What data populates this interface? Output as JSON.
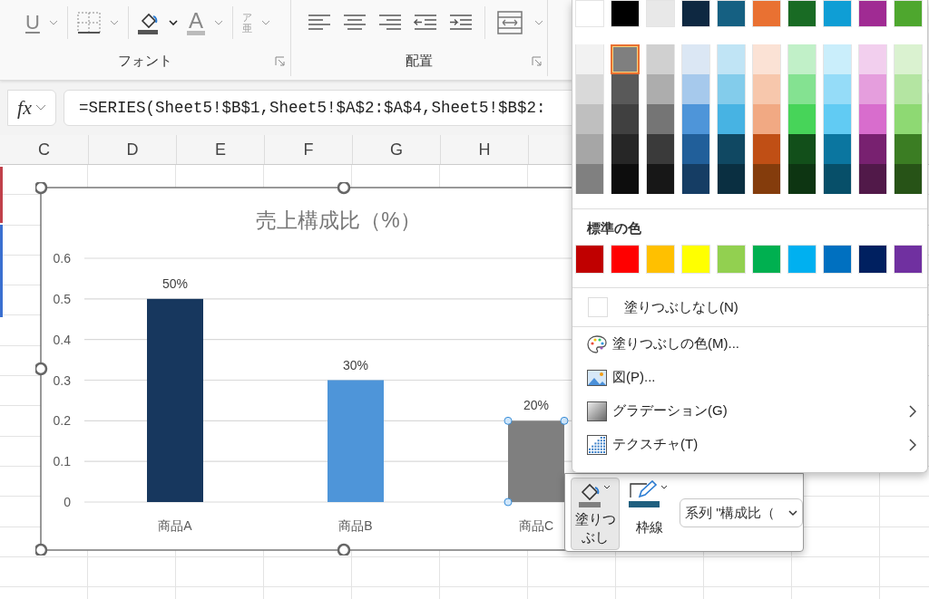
{
  "ribbon": {
    "font_group": {
      "label": "フォント",
      "underline_glyph": "U",
      "font_color_glyph": "A",
      "phonetic_glyphs": [
        "ア",
        "亜"
      ]
    },
    "alignment_group": {
      "label": "配置"
    }
  },
  "formula_bar": {
    "fx": "fx",
    "formula": "=SERIES(Sheet5!$B$1,Sheet5!$A$2:$A$4,Sheet5!$B$2:"
  },
  "columns": [
    "C",
    "D",
    "E",
    "F",
    "G",
    "H"
  ],
  "chart": {
    "points": [
      {
        "selected": false
      },
      {
        "selected": false
      },
      {
        "selected": true
      }
    ],
    "chart_data": {
      "type": "bar",
      "title": "売上構成比（%）",
      "categories": [
        "商品A",
        "商品B",
        "商品C"
      ],
      "grid": true,
      "series": [
        {
          "colors": [
            "#17375e",
            "#4e95d9",
            "#7f7f7f"
          ],
          "values": [
            0.5,
            0.3,
            0.2
          ]
        }
      ],
      "ylim": [
        0,
        0.6
      ],
      "yticks": [
        0,
        0.1,
        0.2,
        0.3,
        0.4,
        0.5,
        0.6
      ],
      "value_labels": [
        "50%",
        "30%",
        "20%"
      ]
    }
  },
  "fill_menu": {
    "theme_top": [
      {
        "color": "#ffffff",
        "selected": false
      },
      {
        "color": "#000000",
        "selected": false
      },
      {
        "color": "#e8e8e8",
        "selected": false
      },
      {
        "color": "#0e2841",
        "selected": false
      },
      {
        "color": "#156082",
        "selected": false
      },
      {
        "color": "#e97132",
        "selected": false
      },
      {
        "color": "#196b24",
        "selected": false
      },
      {
        "color": "#0f9ed5",
        "selected": false
      },
      {
        "color": "#a02b93",
        "selected": false
      },
      {
        "color": "#4ea72e",
        "selected": false
      }
    ],
    "theme_shades": [
      [
        {
          "color": "#f2f2f2",
          "selected": false
        },
        {
          "color": "#7f7f7f",
          "selected": true
        },
        {
          "color": "#d0d0d0",
          "selected": false
        },
        {
          "color": "#dbe7f4",
          "selected": false
        },
        {
          "color": "#c0e4f5",
          "selected": false
        },
        {
          "color": "#fbe2d5",
          "selected": false
        },
        {
          "color": "#c1f0c8",
          "selected": false
        },
        {
          "color": "#caeefb",
          "selected": false
        },
        {
          "color": "#f2cfee",
          "selected": false
        },
        {
          "color": "#daf2d0",
          "selected": false
        }
      ],
      [
        {
          "color": "#d9d9d9",
          "selected": false
        },
        {
          "color": "#595959",
          "selected": false
        },
        {
          "color": "#adadad",
          "selected": false
        },
        {
          "color": "#a6c9ec",
          "selected": false
        },
        {
          "color": "#83cceb",
          "selected": false
        },
        {
          "color": "#f7c7ac",
          "selected": false
        },
        {
          "color": "#84e291",
          "selected": false
        },
        {
          "color": "#95dcf8",
          "selected": false
        },
        {
          "color": "#e59edd",
          "selected": false
        },
        {
          "color": "#b4e5a2",
          "selected": false
        }
      ],
      [
        {
          "color": "#bfbfbf",
          "selected": false
        },
        {
          "color": "#404040",
          "selected": false
        },
        {
          "color": "#757575",
          "selected": false
        },
        {
          "color": "#4e95d9",
          "selected": false
        },
        {
          "color": "#47b3e3",
          "selected": false
        },
        {
          "color": "#f1a983",
          "selected": false
        },
        {
          "color": "#47d459",
          "selected": false
        },
        {
          "color": "#61cbf3",
          "selected": false
        },
        {
          "color": "#d86dcd",
          "selected": false
        },
        {
          "color": "#8ed973",
          "selected": false
        }
      ],
      [
        {
          "color": "#a6a6a6",
          "selected": false
        },
        {
          "color": "#262626",
          "selected": false
        },
        {
          "color": "#3a3a3a",
          "selected": false
        },
        {
          "color": "#215f9a",
          "selected": false
        },
        {
          "color": "#104862",
          "selected": false
        },
        {
          "color": "#c04f15",
          "selected": false
        },
        {
          "color": "#124f1a",
          "selected": false
        },
        {
          "color": "#0b76a0",
          "selected": false
        },
        {
          "color": "#782170",
          "selected": false
        },
        {
          "color": "#3b7d23",
          "selected": false
        }
      ],
      [
        {
          "color": "#808080",
          "selected": false
        },
        {
          "color": "#0d0d0d",
          "selected": false
        },
        {
          "color": "#171717",
          "selected": false
        },
        {
          "color": "#153d64",
          "selected": false
        },
        {
          "color": "#0a2f41",
          "selected": false
        },
        {
          "color": "#843c0c",
          "selected": false
        },
        {
          "color": "#0d3512",
          "selected": false
        },
        {
          "color": "#074f69",
          "selected": false
        },
        {
          "color": "#511949",
          "selected": false
        },
        {
          "color": "#275317",
          "selected": false
        }
      ]
    ],
    "standard_heading": "標準の色",
    "standard": [
      {
        "color": "#c00000",
        "selected": false
      },
      {
        "color": "#ff0000",
        "selected": false
      },
      {
        "color": "#ffc000",
        "selected": false
      },
      {
        "color": "#ffff00",
        "selected": false
      },
      {
        "color": "#92d050",
        "selected": false
      },
      {
        "color": "#00b050",
        "selected": false
      },
      {
        "color": "#00b0f0",
        "selected": false
      },
      {
        "color": "#0070c0",
        "selected": false
      },
      {
        "color": "#002060",
        "selected": false
      },
      {
        "color": "#7030a0",
        "selected": false
      }
    ],
    "items": [
      {
        "kind": "no_fill",
        "label": "塗りつぶしなし(N)",
        "submenu": false
      },
      {
        "kind": "more_colors",
        "label": "塗りつぶしの色(M)...",
        "submenu": false
      },
      {
        "kind": "picture",
        "label": "図(P)...",
        "submenu": false
      },
      {
        "kind": "gradient",
        "label": "グラデーション(G)",
        "submenu": true
      },
      {
        "kind": "texture",
        "label": "テクスチャ(T)",
        "submenu": true
      }
    ]
  },
  "mini_toolbar": {
    "fill_button": {
      "label": "塗りつぶし",
      "pressed": true,
      "color": "#7f7f7f"
    },
    "outline_button": {
      "label": "枠線",
      "pressed": false,
      "color": "#1f5f7f"
    },
    "series_dropdown": {
      "value": "系列 \"構成比（"
    }
  }
}
